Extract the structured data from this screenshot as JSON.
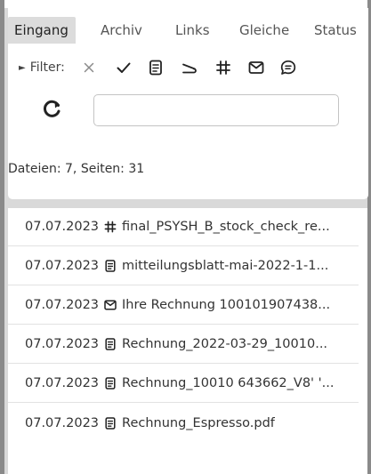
{
  "tabs": [
    {
      "label": "Eingang",
      "active": true
    },
    {
      "label": "Archiv",
      "active": false
    },
    {
      "label": "Links",
      "active": false
    },
    {
      "label": "Gleiche",
      "active": false
    },
    {
      "label": "Status",
      "active": false
    }
  ],
  "filter": {
    "label": "Filter:",
    "icons": [
      "clear-icon",
      "check-icon",
      "document-icon",
      "scan-icon",
      "grid-icon",
      "mail-icon",
      "chat-icon"
    ]
  },
  "search": {
    "value": "",
    "placeholder": ""
  },
  "stats": "Dateien: 7, Seiten: 31",
  "files": [
    {
      "date": "07.07.2023",
      "icon": "grid-icon",
      "name": "final_PSYSH_B_stock_check_re..."
    },
    {
      "date": "07.07.2023",
      "icon": "document-icon",
      "name": "mitteilungsblatt-mai-2022-1-1..."
    },
    {
      "date": "07.07.2023",
      "icon": "mail-icon",
      "name": "Ihre Rechnung 100101907438..."
    },
    {
      "date": "07.07.2023",
      "icon": "document-icon",
      "name": "Rechnung_2022-03-29_10010..."
    },
    {
      "date": "07.07.2023",
      "icon": "document-icon",
      "name": "Rechnung_10010 643662_V8' '..."
    },
    {
      "date": "07.07.2023",
      "icon": "document-icon",
      "name": "Rechnung_Espresso.pdf"
    }
  ],
  "colors": {
    "icon": "#222222",
    "active_tab_bg": "#dcdcdc",
    "frame": "#8a8a8a"
  }
}
